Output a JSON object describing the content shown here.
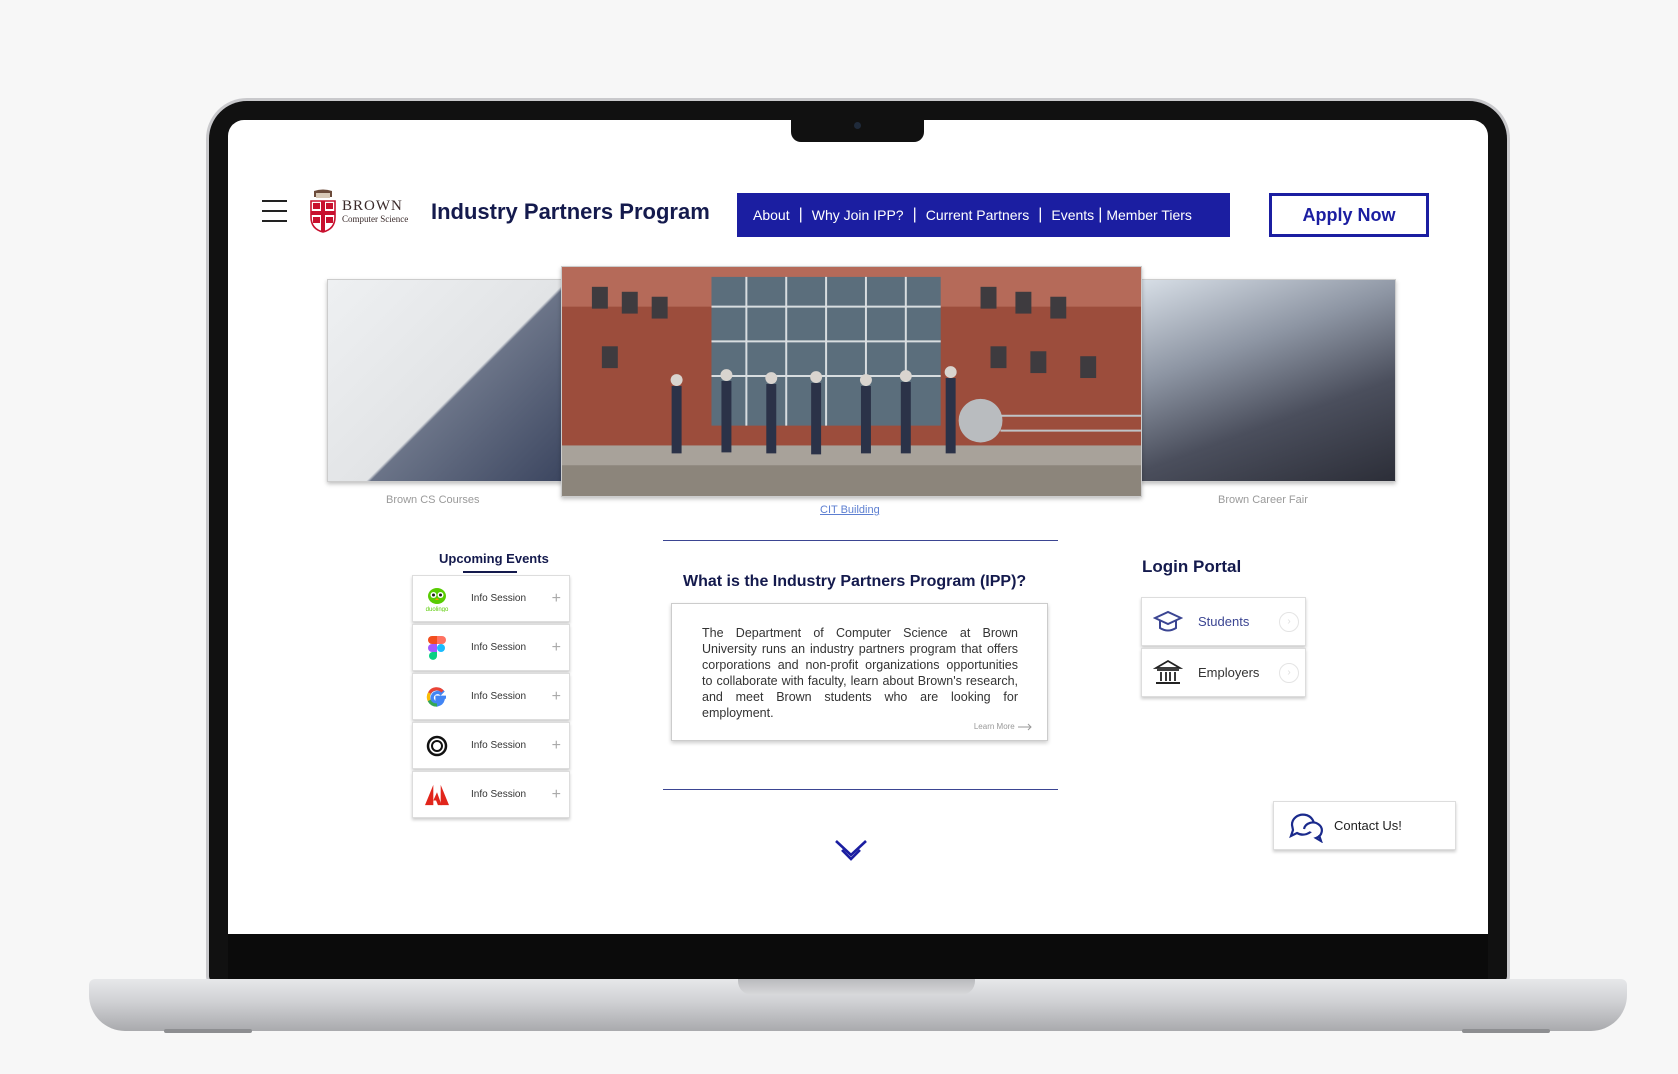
{
  "header": {
    "brand_name": "BROWN",
    "brand_sub": "Computer Science",
    "title": "Industry Partners Program",
    "nav": [
      "About",
      "Why Join IPP?",
      "Current Partners",
      "Events",
      "Member Tiers"
    ],
    "apply_label": "Apply Now"
  },
  "carousel": {
    "captions": [
      "Brown CS Courses",
      "CIT Building",
      "Brown Career Fair"
    ]
  },
  "events": {
    "title": "Upcoming Events",
    "items": [
      {
        "logo": "duolingo-icon",
        "logo_text": "duolingo",
        "label": "Info Session"
      },
      {
        "logo": "figma-icon",
        "label": "Info Session"
      },
      {
        "logo": "google-icon",
        "label": "Info Session"
      },
      {
        "logo": "openai-icon",
        "label": "Info Session"
      },
      {
        "logo": "adobe-icon",
        "label": "Info Session"
      }
    ]
  },
  "ipp": {
    "title": "What is the Industry Partners Program (IPP)?",
    "body": "The Department of Computer Science at Brown University runs an industry partners program that offers corporations and non-profit organizations opportunities to collaborate with faculty, learn about Brown's research, and meet Brown students who are looking for employment.",
    "learn_more": "Learn More"
  },
  "login": {
    "title": "Login Portal",
    "students": "Students",
    "employers": "Employers"
  },
  "contact": {
    "label": "Contact Us!"
  },
  "colors": {
    "brand_blue": "#1b1ea1",
    "navy_text": "#141a4d",
    "brown_red": "#c8102e"
  }
}
